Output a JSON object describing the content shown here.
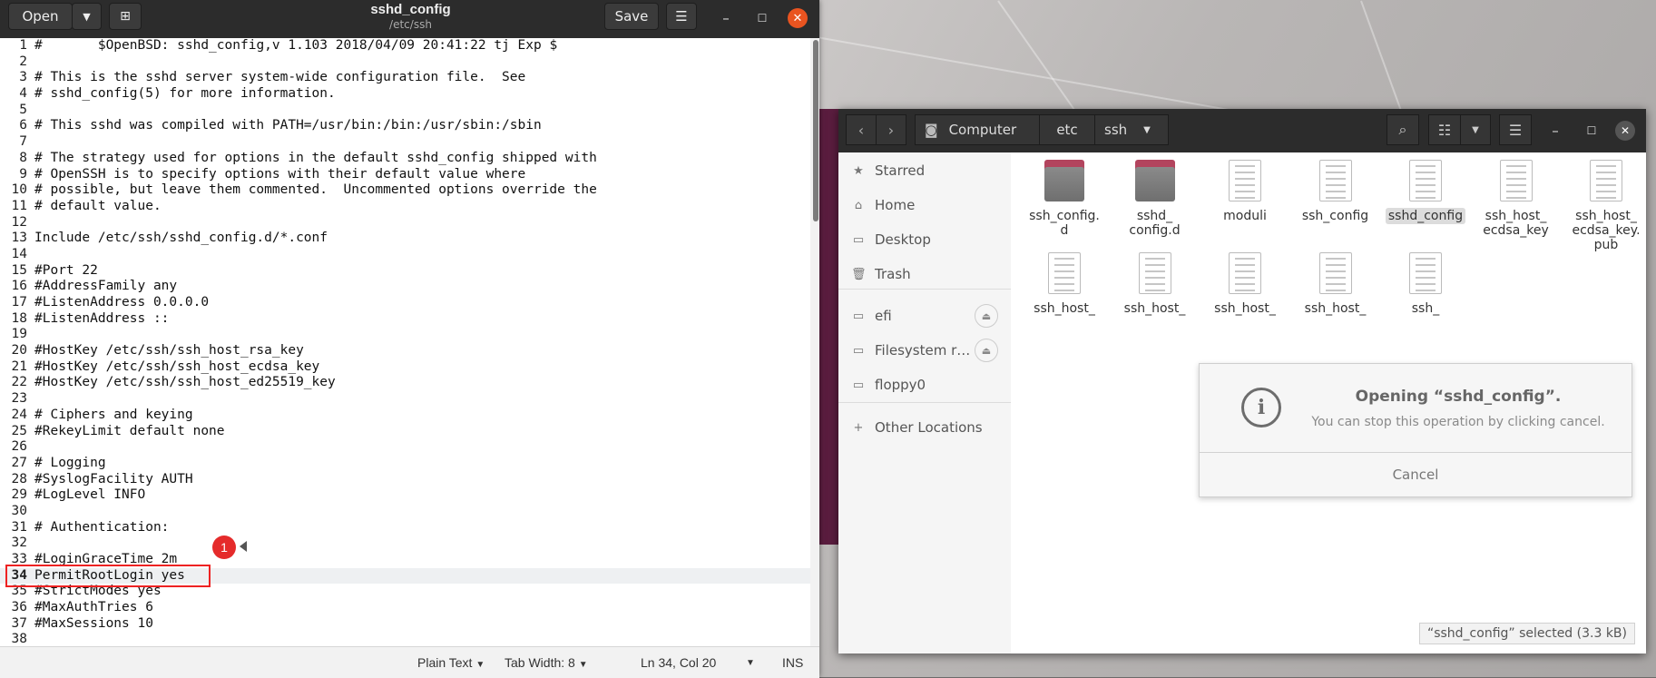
{
  "gedit": {
    "open_label": "Open",
    "save_label": "Save",
    "title": "sshd_config",
    "subtitle": "/etc/ssh",
    "lines": [
      {
        "n": "1",
        "text": "#\t$OpenBSD: sshd_config,v 1.103 2018/04/09 20:41:22 tj Exp $"
      },
      {
        "n": "2",
        "text": ""
      },
      {
        "n": "3",
        "text": "# This is the sshd server system-wide configuration file.  See"
      },
      {
        "n": "4",
        "text": "# sshd_config(5) for more information."
      },
      {
        "n": "5",
        "text": ""
      },
      {
        "n": "6",
        "text": "# This sshd was compiled with PATH=/usr/bin:/bin:/usr/sbin:/sbin"
      },
      {
        "n": "7",
        "text": ""
      },
      {
        "n": "8",
        "text": "# The strategy used for options in the default sshd_config shipped with"
      },
      {
        "n": "9",
        "text": "# OpenSSH is to specify options with their default value where"
      },
      {
        "n": "10",
        "text": "# possible, but leave them commented.  Uncommented options override the"
      },
      {
        "n": "11",
        "text": "# default value."
      },
      {
        "n": "12",
        "text": ""
      },
      {
        "n": "13",
        "text": "Include /etc/ssh/sshd_config.d/*.conf"
      },
      {
        "n": "14",
        "text": ""
      },
      {
        "n": "15",
        "text": "#Port 22"
      },
      {
        "n": "16",
        "text": "#AddressFamily any"
      },
      {
        "n": "17",
        "text": "#ListenAddress 0.0.0.0"
      },
      {
        "n": "18",
        "text": "#ListenAddress ::"
      },
      {
        "n": "19",
        "text": ""
      },
      {
        "n": "20",
        "text": "#HostKey /etc/ssh/ssh_host_rsa_key"
      },
      {
        "n": "21",
        "text": "#HostKey /etc/ssh/ssh_host_ecdsa_key"
      },
      {
        "n": "22",
        "text": "#HostKey /etc/ssh/ssh_host_ed25519_key"
      },
      {
        "n": "23",
        "text": ""
      },
      {
        "n": "24",
        "text": "# Ciphers and keying"
      },
      {
        "n": "25",
        "text": "#RekeyLimit default none"
      },
      {
        "n": "26",
        "text": ""
      },
      {
        "n": "27",
        "text": "# Logging"
      },
      {
        "n": "28",
        "text": "#SyslogFacility AUTH"
      },
      {
        "n": "29",
        "text": "#LogLevel INFO"
      },
      {
        "n": "30",
        "text": ""
      },
      {
        "n": "31",
        "text": "# Authentication:"
      },
      {
        "n": "32",
        "text": ""
      },
      {
        "n": "33",
        "text": "#LoginGraceTime 2m"
      },
      {
        "n": "34",
        "text": "PermitRootLogin yes"
      },
      {
        "n": "35",
        "text": "#StrictModes yes"
      },
      {
        "n": "36",
        "text": "#MaxAuthTries 6"
      },
      {
        "n": "37",
        "text": "#MaxSessions 10"
      },
      {
        "n": "38",
        "text": ""
      }
    ],
    "current_line": "34",
    "annotation_badge": "1",
    "status": {
      "syntax": "Plain Text",
      "tab_width": "Tab Width: 8",
      "position": "Ln 34, Col 20",
      "mode": "INS"
    }
  },
  "files": {
    "breadcrumb": [
      "Computer",
      "etc",
      "ssh"
    ],
    "sidebar": [
      {
        "label": "Starred",
        "icon": "star-icon"
      },
      {
        "label": "Home",
        "icon": "home-icon"
      },
      {
        "label": "Desktop",
        "icon": "desktop-icon"
      },
      {
        "label": "Trash",
        "icon": "trash-icon"
      },
      {
        "label": "efi",
        "icon": "drive-icon"
      },
      {
        "label": "Filesystem r…",
        "icon": "drive-icon"
      },
      {
        "label": "floppy0",
        "icon": "drive-icon"
      },
      {
        "label": "Other Locations",
        "icon": "plus-icon"
      }
    ],
    "items_row1": [
      {
        "name": "ssh_config.\nd",
        "type": "folder"
      },
      {
        "name": "sshd_\nconfig.d",
        "type": "folder"
      },
      {
        "name": "moduli",
        "type": "file"
      },
      {
        "name": "ssh_config",
        "type": "file"
      },
      {
        "name": "sshd_config",
        "type": "file",
        "selected": true
      },
      {
        "name": "ssh_host_\necdsa_key",
        "type": "file"
      },
      {
        "name": "ssh_host_\necdsa_key.\npub",
        "type": "file"
      }
    ],
    "items_row2": [
      {
        "name": "ssh_host_",
        "type": "file"
      },
      {
        "name": "ssh_host_",
        "type": "file"
      },
      {
        "name": "ssh_host_",
        "type": "file"
      },
      {
        "name": "ssh_host_",
        "type": "file"
      },
      {
        "name": "ssh_",
        "type": "file"
      }
    ],
    "dialog": {
      "title": "Opening “sshd_config”.",
      "message": "You can stop this operation by clicking cancel.",
      "cancel_label": "Cancel"
    },
    "status": "“sshd_config” selected  (3.3 kB)"
  },
  "colors": {
    "accent": "#e95420",
    "highlight": "#e22222",
    "folder": "#b3445e"
  }
}
